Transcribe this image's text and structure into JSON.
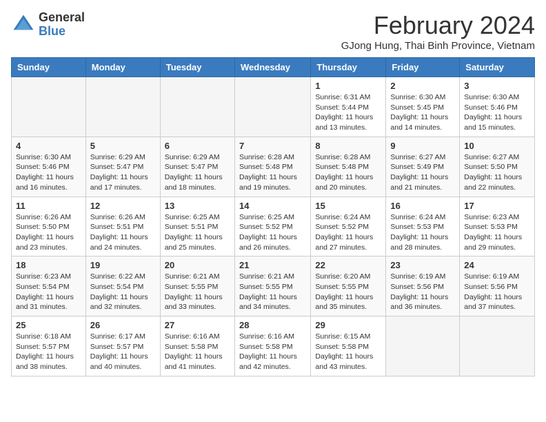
{
  "header": {
    "logo_general": "General",
    "logo_blue": "Blue",
    "month_title": "February 2024",
    "subtitle": "GJong Hung, Thai Binh Province, Vietnam"
  },
  "days_of_week": [
    "Sunday",
    "Monday",
    "Tuesday",
    "Wednesday",
    "Thursday",
    "Friday",
    "Saturday"
  ],
  "weeks": [
    [
      {
        "day": "",
        "info": ""
      },
      {
        "day": "",
        "info": ""
      },
      {
        "day": "",
        "info": ""
      },
      {
        "day": "",
        "info": ""
      },
      {
        "day": "1",
        "info": "Sunrise: 6:31 AM\nSunset: 5:44 PM\nDaylight: 11 hours and 13 minutes."
      },
      {
        "day": "2",
        "info": "Sunrise: 6:30 AM\nSunset: 5:45 PM\nDaylight: 11 hours and 14 minutes."
      },
      {
        "day": "3",
        "info": "Sunrise: 6:30 AM\nSunset: 5:46 PM\nDaylight: 11 hours and 15 minutes."
      }
    ],
    [
      {
        "day": "4",
        "info": "Sunrise: 6:30 AM\nSunset: 5:46 PM\nDaylight: 11 hours and 16 minutes."
      },
      {
        "day": "5",
        "info": "Sunrise: 6:29 AM\nSunset: 5:47 PM\nDaylight: 11 hours and 17 minutes."
      },
      {
        "day": "6",
        "info": "Sunrise: 6:29 AM\nSunset: 5:47 PM\nDaylight: 11 hours and 18 minutes."
      },
      {
        "day": "7",
        "info": "Sunrise: 6:28 AM\nSunset: 5:48 PM\nDaylight: 11 hours and 19 minutes."
      },
      {
        "day": "8",
        "info": "Sunrise: 6:28 AM\nSunset: 5:48 PM\nDaylight: 11 hours and 20 minutes."
      },
      {
        "day": "9",
        "info": "Sunrise: 6:27 AM\nSunset: 5:49 PM\nDaylight: 11 hours and 21 minutes."
      },
      {
        "day": "10",
        "info": "Sunrise: 6:27 AM\nSunset: 5:50 PM\nDaylight: 11 hours and 22 minutes."
      }
    ],
    [
      {
        "day": "11",
        "info": "Sunrise: 6:26 AM\nSunset: 5:50 PM\nDaylight: 11 hours and 23 minutes."
      },
      {
        "day": "12",
        "info": "Sunrise: 6:26 AM\nSunset: 5:51 PM\nDaylight: 11 hours and 24 minutes."
      },
      {
        "day": "13",
        "info": "Sunrise: 6:25 AM\nSunset: 5:51 PM\nDaylight: 11 hours and 25 minutes."
      },
      {
        "day": "14",
        "info": "Sunrise: 6:25 AM\nSunset: 5:52 PM\nDaylight: 11 hours and 26 minutes."
      },
      {
        "day": "15",
        "info": "Sunrise: 6:24 AM\nSunset: 5:52 PM\nDaylight: 11 hours and 27 minutes."
      },
      {
        "day": "16",
        "info": "Sunrise: 6:24 AM\nSunset: 5:53 PM\nDaylight: 11 hours and 28 minutes."
      },
      {
        "day": "17",
        "info": "Sunrise: 6:23 AM\nSunset: 5:53 PM\nDaylight: 11 hours and 29 minutes."
      }
    ],
    [
      {
        "day": "18",
        "info": "Sunrise: 6:23 AM\nSunset: 5:54 PM\nDaylight: 11 hours and 31 minutes."
      },
      {
        "day": "19",
        "info": "Sunrise: 6:22 AM\nSunset: 5:54 PM\nDaylight: 11 hours and 32 minutes."
      },
      {
        "day": "20",
        "info": "Sunrise: 6:21 AM\nSunset: 5:55 PM\nDaylight: 11 hours and 33 minutes."
      },
      {
        "day": "21",
        "info": "Sunrise: 6:21 AM\nSunset: 5:55 PM\nDaylight: 11 hours and 34 minutes."
      },
      {
        "day": "22",
        "info": "Sunrise: 6:20 AM\nSunset: 5:55 PM\nDaylight: 11 hours and 35 minutes."
      },
      {
        "day": "23",
        "info": "Sunrise: 6:19 AM\nSunset: 5:56 PM\nDaylight: 11 hours and 36 minutes."
      },
      {
        "day": "24",
        "info": "Sunrise: 6:19 AM\nSunset: 5:56 PM\nDaylight: 11 hours and 37 minutes."
      }
    ],
    [
      {
        "day": "25",
        "info": "Sunrise: 6:18 AM\nSunset: 5:57 PM\nDaylight: 11 hours and 38 minutes."
      },
      {
        "day": "26",
        "info": "Sunrise: 6:17 AM\nSunset: 5:57 PM\nDaylight: 11 hours and 40 minutes."
      },
      {
        "day": "27",
        "info": "Sunrise: 6:16 AM\nSunset: 5:58 PM\nDaylight: 11 hours and 41 minutes."
      },
      {
        "day": "28",
        "info": "Sunrise: 6:16 AM\nSunset: 5:58 PM\nDaylight: 11 hours and 42 minutes."
      },
      {
        "day": "29",
        "info": "Sunrise: 6:15 AM\nSunset: 5:58 PM\nDaylight: 11 hours and 43 minutes."
      },
      {
        "day": "",
        "info": ""
      },
      {
        "day": "",
        "info": ""
      }
    ]
  ]
}
